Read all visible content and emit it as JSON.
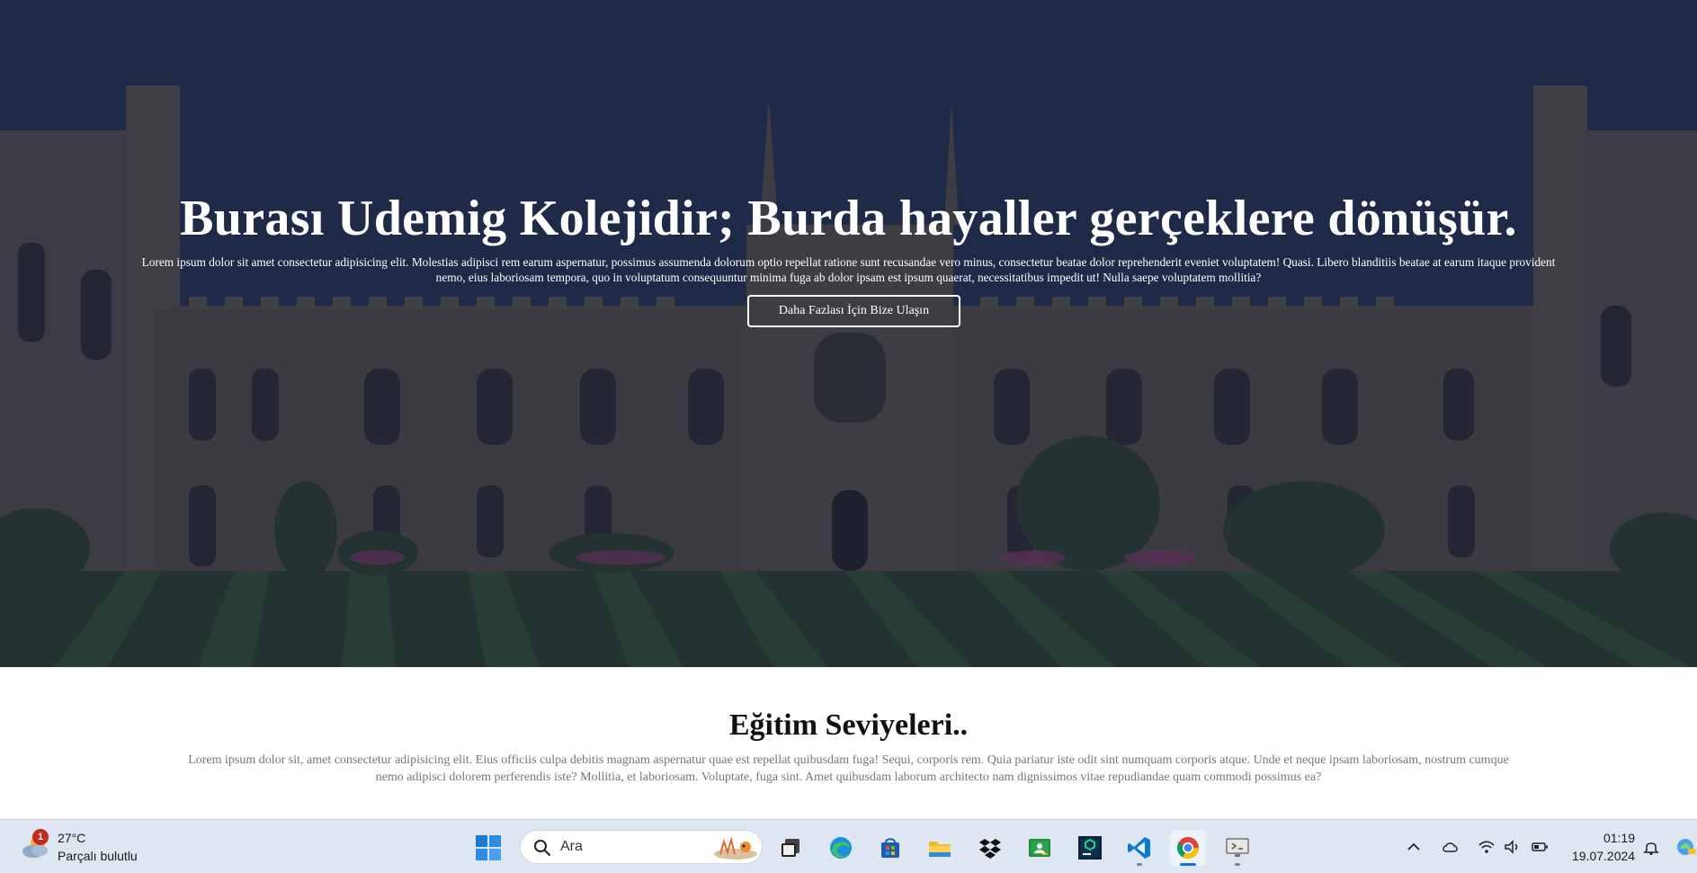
{
  "hero": {
    "title": "Burası Udemig Kolejidir; Burda hayaller gerçeklere dönüşür.",
    "text": "Lorem ipsum dolor sit amet consectetur adipisicing elit. Molestias adipisci rem earum aspernatur, possimus assumenda dolorum optio repellat ratione sunt recusandae vero minus, consectetur beatae dolor reprehenderit eveniet voluptatem! Quasi. Libero blanditiis beatae at earum itaque provident nemo, eius laboriosam tempora, quo in voluptatum consequuntur minima fuga ab dolor ipsam est ipsum quaerat, necessitatibus impedit ut! Nulla saepe voluptatem mollitia?",
    "button_label": "Daha Fazlası İçin Bize Ulaşın",
    "overlay_color": "#1f2c4b"
  },
  "section": {
    "title": "Eğitim Seviyeleri..",
    "text": "Lorem ipsum dolor sit, amet consectetur adipisicing elit. Eius officiis culpa debitis magnam aspernatur quae est repellat quibusdam fuga! Sequi, corporis rem. Quia pariatur iste odit sint numquam corporis atque. Unde et neque ipsam laboriosam, nostrum cumque nemo adipisci dolorem perferendis iste? Mollitia, et laboriosam. Voluptate, fuga sint. Amet quibusdam laborum architecto nam dignissimos vitae repudiandae quam commodi possimus ea?"
  },
  "taskbar": {
    "weather": {
      "badge": "1",
      "temp": "27°C",
      "desc": "Parçalı bulutlu"
    },
    "search_placeholder": "Ara",
    "apps": [
      {
        "name": "task-view"
      },
      {
        "name": "edge"
      },
      {
        "name": "microsoft-store"
      },
      {
        "name": "file-explorer"
      },
      {
        "name": "dropbox"
      },
      {
        "name": "google-classroom"
      },
      {
        "name": "pycharm"
      },
      {
        "name": "vscode"
      },
      {
        "name": "chrome"
      },
      {
        "name": "remote-desktop"
      }
    ],
    "clock": {
      "time": "01:19",
      "date": "19.07.2024"
    },
    "accent": "#1a73d9"
  }
}
